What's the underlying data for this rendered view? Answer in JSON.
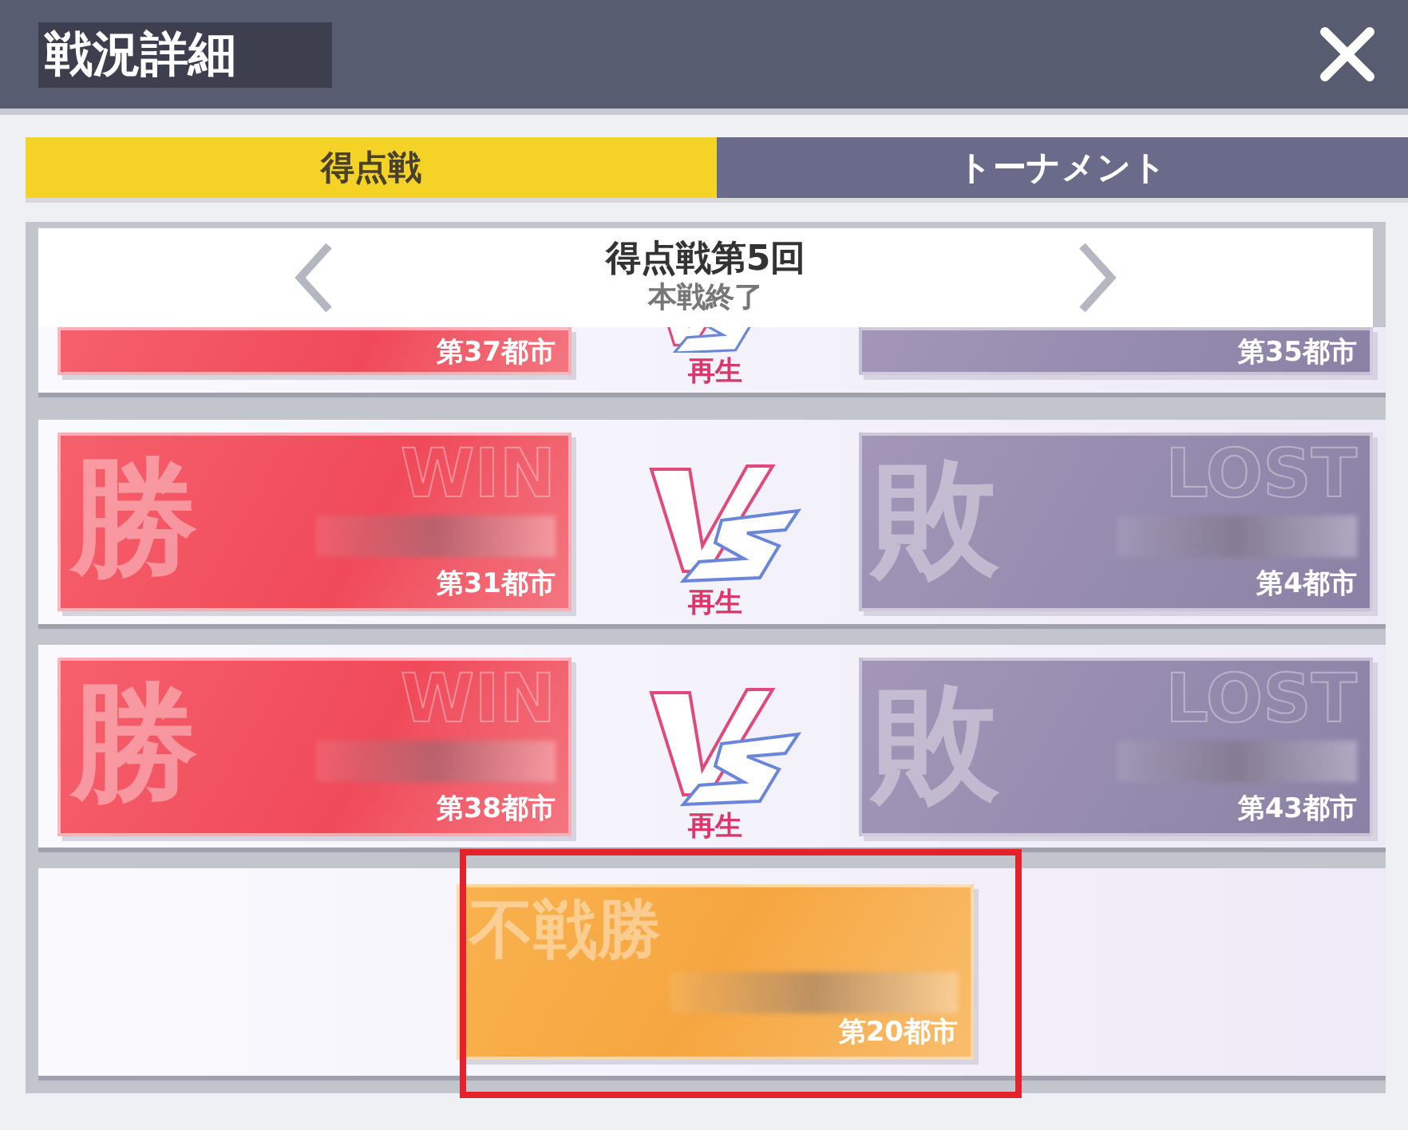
{
  "window": {
    "title": "戦況詳細"
  },
  "tabs": [
    {
      "label": "得点戦",
      "selected": true
    },
    {
      "label": "トーナメント",
      "selected": false
    }
  ],
  "round": {
    "title": "得点戦第5回",
    "status": "本戦終了"
  },
  "matches": [
    {
      "kind": "partial",
      "replay": "再生",
      "left": {
        "kind": "win",
        "city": "第37都市"
      },
      "right": {
        "kind": "lost",
        "city": "第35都市"
      }
    },
    {
      "kind": "full",
      "replay": "再生",
      "left": {
        "kind": "win",
        "mark": "勝",
        "word": "WIN",
        "city": "第31都市"
      },
      "right": {
        "kind": "lost",
        "mark": "敗",
        "word": "LOST",
        "city": "第4都市"
      }
    },
    {
      "kind": "full",
      "replay": "再生",
      "left": {
        "kind": "win",
        "mark": "勝",
        "word": "WIN",
        "city": "第38都市"
      },
      "right": {
        "kind": "lost",
        "mark": "敗",
        "word": "LOST",
        "city": "第43都市"
      }
    },
    {
      "kind": "bye",
      "highlighted": true,
      "card": {
        "kind": "bye",
        "mark": "不戦勝",
        "city": "第20都市"
      }
    }
  ]
}
